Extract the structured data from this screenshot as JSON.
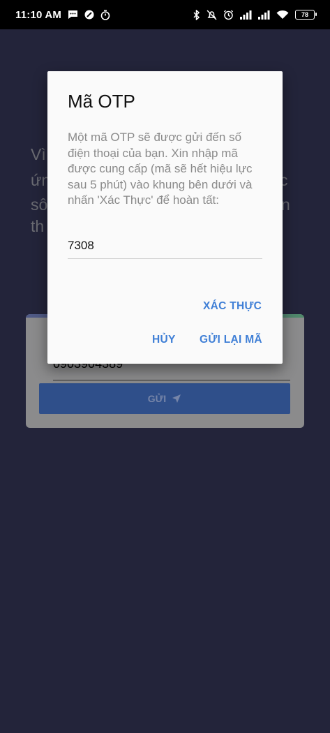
{
  "status_bar": {
    "time": "11:10 AM",
    "battery": "78",
    "left_icons": [
      "message-icon",
      "do-not-disturb-icon",
      "timer-icon"
    ],
    "right_icons": [
      "bluetooth-icon",
      "notifications-off-icon",
      "alarm-icon",
      "signal-icon",
      "signal-icon",
      "wifi-icon",
      "battery-icon"
    ]
  },
  "background": {
    "text_fragments": [
      "Vì",
      "ứn",
      "c",
      "sô",
      "n",
      "th"
    ],
    "phone_number": "0903904389",
    "send_label": "GỬI"
  },
  "dialog": {
    "title": "Mã OTP",
    "message": "Một mã OTP sẽ được gửi đến số điện thoại của bạn. Xin nhập mã được cung cấp (mã sẽ hết hiệu lực sau 5 phút) vào khung bên dưới và nhấn 'Xác Thực' để hoàn tất:",
    "otp_value": "7308",
    "verify_label": "XÁC THỰC",
    "cancel_label": "HỦY",
    "resend_label": "GỬI LẠI MÃ",
    "accent_color": "#3f7fd6"
  }
}
